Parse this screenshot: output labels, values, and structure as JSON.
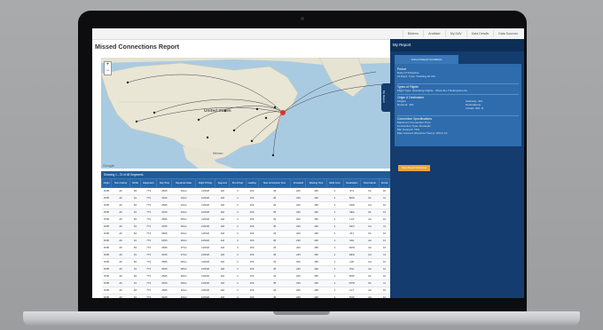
{
  "nav": {
    "links": [
      "Bilderro",
      "Andfater",
      "My DAV",
      "Data Detalls",
      "Data Sources"
    ]
  },
  "page": {
    "title": "Missed Connections Report"
  },
  "map": {
    "country_label": "United States",
    "mexico_label": "Mexico",
    "google_label": "Google"
  },
  "panel": {
    "header": "My Report",
    "tab": "Current Report Conditions",
    "toggle": "My Report",
    "sections": [
      {
        "title": "Period",
        "lines": [
          "Date Of Schedule",
          "11 Days: Type: Tracking All Info"
        ]
      },
      {
        "title": "Types of Flights",
        "lines": [
          "Flight Type: Operating Flights · Show the Thinking Events"
        ]
      },
      {
        "title": "Origin & Destination",
        "lines": [
          "Origins",
          "Network: JFK"
        ]
      },
      {
        "title": "Connection Specifications",
        "lines": [
          "Maximum Connection Time",
          "Connection Type: Domestic",
          "Min Connect: TFS",
          "Max Connect (Reverse Hours): 180 to 12"
        ]
      }
    ],
    "right_col": [
      "Gateway: JFK",
      "Destinations",
      "Include ISO: N"
    ],
    "button": "Save Report Definition"
  },
  "table": {
    "caption": "Showing 1 - 21 of 48 Segments",
    "headers": [
      "Origin",
      "Num Carrier",
      "NCNo",
      "Equipment",
      "Dep Time",
      "Departure Date",
      "Flight Of Day",
      "Segment",
      "Pre Arrival",
      "Leading",
      "Max Connection Time",
      "Preceded",
      "Meeting Time",
      "Multi Conn",
      "Destination",
      "Dest Carrier",
      "Arrival"
    ],
    "rows": [
      [
        "DXB",
        "AF",
        "84",
        "773",
        "0845",
        "03Jul",
        "11NSR",
        "AM",
        "3",
        "JFK",
        "43",
        "200",
        "185",
        "1",
        "STL",
        "DL",
        "10"
      ],
      [
        "DXB",
        "AF",
        "91",
        "773",
        "0915",
        "03Jul",
        "12NSR",
        "AM",
        "4",
        "JFK",
        "45",
        "230",
        "190",
        "1",
        "BOS",
        "DL",
        "11"
      ],
      [
        "DXB",
        "AF",
        "84",
        "773",
        "0845",
        "04Jul",
        "11NSR",
        "AM",
        "3",
        "JFK",
        "43",
        "200",
        "185",
        "1",
        "ORD",
        "UA",
        "10"
      ],
      [
        "DXB",
        "AF",
        "91",
        "773",
        "0915",
        "04Jul",
        "12NSR",
        "AM",
        "4",
        "JFK",
        "45",
        "230",
        "190",
        "1",
        "SEA",
        "DL",
        "12"
      ],
      [
        "DXB",
        "AF",
        "84",
        "773",
        "0845",
        "05Jul",
        "11NSR",
        "AM",
        "3",
        "JFK",
        "43",
        "200",
        "185",
        "1",
        "LAX",
        "AA",
        "10"
      ],
      [
        "DXB",
        "AF",
        "91",
        "773",
        "0915",
        "05Jul",
        "12NSR",
        "AM",
        "4",
        "JFK",
        "45",
        "230",
        "190",
        "1",
        "SFO",
        "UA",
        "11"
      ],
      [
        "DXB",
        "AF",
        "84",
        "773",
        "0845",
        "06Jul",
        "11NSR",
        "AM",
        "3",
        "JFK",
        "43",
        "200",
        "185",
        "1",
        "ATL",
        "DL",
        "10"
      ],
      [
        "DXB",
        "AF",
        "91",
        "773",
        "0915",
        "06Jul",
        "12NSR",
        "AM",
        "4",
        "JFK",
        "45",
        "230",
        "190",
        "1",
        "MIA",
        "AA",
        "12"
      ],
      [
        "DXB",
        "AF",
        "84",
        "773",
        "0845",
        "07Jul",
        "11NSR",
        "AM",
        "3",
        "JFK",
        "43",
        "200",
        "185",
        "1",
        "DFW",
        "AA",
        "10"
      ],
      [
        "DXB",
        "AF",
        "91",
        "773",
        "0915",
        "07Jul",
        "12NSR",
        "AM",
        "4",
        "JFK",
        "45",
        "230",
        "190",
        "1",
        "DEN",
        "UA",
        "11"
      ],
      [
        "DXB",
        "AF",
        "84",
        "773",
        "0845",
        "08Jul",
        "11NSR",
        "AM",
        "3",
        "JFK",
        "43",
        "200",
        "185",
        "1",
        "IAD",
        "UA",
        "10"
      ],
      [
        "DXB",
        "AF",
        "91",
        "773",
        "0915",
        "08Jul",
        "12NSR",
        "AM",
        "4",
        "JFK",
        "45",
        "230",
        "190",
        "1",
        "PHL",
        "AA",
        "12"
      ],
      [
        "DXB",
        "AF",
        "84",
        "773",
        "0845",
        "09Jul",
        "11NSR",
        "AM",
        "3",
        "JFK",
        "43",
        "200",
        "185",
        "1",
        "MSP",
        "DL",
        "10"
      ],
      [
        "DXB",
        "AF",
        "91",
        "773",
        "0915",
        "09Jul",
        "12NSR",
        "AM",
        "4",
        "JFK",
        "45",
        "230",
        "190",
        "1",
        "DTW",
        "DL",
        "11"
      ],
      [
        "DXB",
        "AF",
        "84",
        "773",
        "0845",
        "10Jul",
        "11NSR",
        "AM",
        "3",
        "JFK",
        "43",
        "200",
        "185",
        "1",
        "CLT",
        "AA",
        "10"
      ],
      [
        "DXB",
        "AF",
        "91",
        "773",
        "0915",
        "10Jul",
        "12NSR",
        "AM",
        "4",
        "JFK",
        "45",
        "230",
        "190",
        "1",
        "PHX",
        "AA",
        "12"
      ]
    ]
  },
  "colors": {
    "panel": "#143c6e",
    "panel_body": "#2e6cad",
    "table_header": "#2766a8",
    "button": "#e8a33a"
  }
}
